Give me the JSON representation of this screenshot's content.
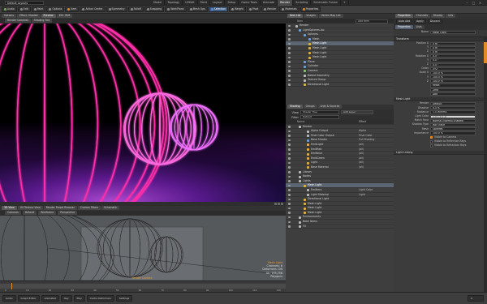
{
  "menubar": {
    "layout": "Default Layouts",
    "tabs": [
      "Model",
      "Topology",
      "UVEdit",
      "Paint",
      "Layout",
      "Setup",
      "Game Tools",
      "Animate",
      "Render",
      "Scripting",
      "Schematic Fusion",
      "+"
    ],
    "active_tab": "Render",
    "window_controls": [
      "–",
      "□",
      "×"
    ]
  },
  "toolbar": {
    "items": [
      {
        "label": "Audio",
        "dot": "g"
      },
      {
        "label": "Edit",
        "dot": ""
      },
      {
        "label": "Paint",
        "dot": ""
      },
      {
        "label": "Options",
        "dot": ""
      },
      {
        "label": "Item",
        "dot": "o"
      },
      {
        "label": "Action Center",
        "dot": ""
      },
      {
        "label": "Symmetry",
        "dot": ""
      },
      {
        "label": "Falloff",
        "dot": ""
      },
      {
        "label": "Snapping",
        "dot": ""
      },
      {
        "label": "WorkPlane",
        "dot": ""
      },
      {
        "label": "Mesh Ops",
        "dot": ""
      },
      {
        "label": "Selection",
        "dot": "b",
        "active": true
      },
      {
        "label": "Weight",
        "dot": ""
      },
      {
        "label": "Pivot",
        "dot": ""
      },
      {
        "label": "Render",
        "dot": ""
      },
      {
        "label": "Materials",
        "dot": ""
      },
      {
        "label": "Properties",
        "dot": "o"
      }
    ]
  },
  "render_view": {
    "tabs": [
      "Options",
      "Effect: Shaded",
      "Preview",
      "IDS: IRrB"
    ],
    "active_tab": "Preview",
    "sub": [
      "Render Cameras",
      "Shading Tint"
    ]
  },
  "viewport": {
    "tabs": [
      "3D View",
      "UV Texture View",
      "Render Preset Browser",
      "Custom Filters",
      "Schematic"
    ],
    "active_tab": "3D View",
    "sub": [
      "Cameras",
      "Default",
      "Wireframe",
      "Perspective"
    ],
    "camera_label": "Render Camera",
    "info": {
      "selected": "Mesh Light",
      "channels": "Channels: 6",
      "deformers": "Deformers: ON",
      "gl": "GL: 193,756",
      "polys": "Polygons",
      "sel": "Ply: 0"
    }
  },
  "timeline": {
    "ticks": [
      "0",
      "10",
      "20",
      "30",
      "40",
      "50",
      "60",
      "70",
      "80",
      "90",
      "100",
      "110",
      "120"
    ]
  },
  "statusbar": {
    "items": [
      "Audio",
      "Graph Editor",
      "Animated",
      "Key",
      "Play",
      "Cache Deformers",
      "Settings"
    ],
    "frame": "0"
  },
  "items_panel": {
    "tabs": [
      "Item List",
      "Images",
      "Vertex Map List"
    ],
    "active_tab": "Item List",
    "col_name": "Item",
    "col_add": "Add Item",
    "rows": [
      {
        "label": "Render",
        "indent": 2,
        "icon": "g"
      },
      {
        "label": "LightSpheres.lxo",
        "indent": 4,
        "icon": "m"
      },
      {
        "label": "Spheres",
        "indent": 7,
        "icon": "m"
      },
      {
        "label": "Mesh",
        "indent": 10,
        "icon": "m"
      },
      {
        "label": "Mesh Light",
        "indent": 10,
        "icon": "y",
        "selected": true
      },
      {
        "label": "Mesh Light",
        "indent": 10,
        "icon": "y"
      },
      {
        "label": "Mesh Light",
        "indent": 10,
        "icon": "y"
      },
      {
        "label": "Mesh Light",
        "indent": 10,
        "icon": "y"
      },
      {
        "label": "Plane",
        "indent": 7,
        "icon": "m"
      },
      {
        "label": "Cylinder",
        "indent": 7,
        "icon": "m"
      },
      {
        "label": "Camera",
        "indent": 7,
        "icon": "c"
      },
      {
        "label": "Baked Geometry",
        "indent": 7,
        "icon": "g"
      },
      {
        "label": "Texture Group",
        "indent": 7,
        "icon": "g"
      },
      {
        "label": "Directional Light",
        "indent": 7,
        "icon": "y"
      }
    ]
  },
  "shader_panel": {
    "tabs": [
      "Shading",
      "Groups",
      "Lists & Sources"
    ],
    "active_tab": "Shading",
    "filter_label": "View",
    "filter_value": "Shader Tree",
    "add_label": "Add Layer",
    "mode_label": "Filter",
    "mode_value": "Default",
    "col_name": "Name",
    "col_effect": "Effect",
    "rows": [
      {
        "label": "Render",
        "indent": 4,
        "val": "",
        "icon": "g"
      },
      {
        "label": "Alpha Output",
        "indent": 9,
        "val": "Alpha",
        "icon": "g"
      },
      {
        "label": "Final Color Output",
        "indent": 9,
        "val": "Final Color",
        "icon": "g"
      },
      {
        "label": "Base Shader",
        "indent": 9,
        "val": "Full Shading",
        "icon": "m"
      },
      {
        "label": "EmitLight",
        "indent": 9,
        "val": "(all)",
        "icon": "o"
      },
      {
        "label": "EmitRed",
        "indent": 9,
        "val": "(all)",
        "icon": "o"
      },
      {
        "label": "Emitblue",
        "indent": 9,
        "val": "(all)",
        "icon": "o"
      },
      {
        "label": "EmitGreen",
        "indent": 9,
        "val": "(all)",
        "icon": "o"
      },
      {
        "label": "Light",
        "indent": 9,
        "val": "(all)",
        "icon": "o"
      },
      {
        "label": "Base Material",
        "indent": 9,
        "val": "(all)",
        "icon": "o"
      },
      {
        "label": "Library",
        "indent": 4,
        "val": "",
        "icon": "g"
      },
      {
        "label": "Nodes",
        "indent": 4,
        "val": "",
        "icon": "g"
      },
      {
        "label": "Lights",
        "indent": 4,
        "val": "",
        "icon": "g"
      },
      {
        "label": "Mesh Light",
        "indent": 7,
        "val": "",
        "icon": "y",
        "selected": true
      },
      {
        "label": "Emitters",
        "indent": 9,
        "val": "Light Color",
        "icon": "g"
      },
      {
        "label": "Light Material",
        "indent": 9,
        "val": "Light",
        "icon": "g"
      },
      {
        "label": "Directional Light",
        "indent": 7,
        "val": "",
        "icon": "y"
      },
      {
        "label": "Mesh Light",
        "indent": 7,
        "val": "",
        "icon": "y"
      },
      {
        "label": "Mesh Light",
        "indent": 7,
        "val": "",
        "icon": "y"
      },
      {
        "label": "Mesh Light",
        "indent": 7,
        "val": "",
        "icon": "y"
      },
      {
        "label": "Environments",
        "indent": 4,
        "val": "",
        "icon": "g"
      },
      {
        "label": "Bake Items",
        "indent": 4,
        "val": "",
        "icon": "g"
      },
      {
        "label": "FX",
        "indent": 4,
        "val": "",
        "icon": "g"
      }
    ]
  },
  "properties": {
    "tabs": [
      "Properties",
      "Channels",
      "Display",
      "Info"
    ],
    "active_tab": "Properties",
    "bar": [
      "Auto Add",
      "Apply",
      "Discard"
    ],
    "subtabs": [
      "Properties",
      "Lists"
    ],
    "name_label": "Name",
    "name_value": "Mesh Light",
    "transform_title": "Transform",
    "transform": [
      {
        "label": "Position X",
        "value": "0 m"
      },
      {
        "label": "Y",
        "value": "0 m"
      },
      {
        "label": "Z",
        "value": "0 m"
      },
      {
        "label": "Rotation X",
        "value": "0.0 °"
      },
      {
        "label": "Y",
        "value": "0.0 °"
      },
      {
        "label": "Z",
        "value": "0.0 °"
      },
      {
        "label": "Order",
        "value": "XYZ"
      },
      {
        "label": "Scale X",
        "value": "100.0 %"
      },
      {
        "label": "Y",
        "value": "100.0 %"
      },
      {
        "label": "Z",
        "value": "100.0 %"
      },
      {
        "label": "",
        "value": "Reset"
      },
      {
        "label": "",
        "value": "Zero"
      },
      {
        "label": "",
        "value": "Add"
      }
    ],
    "light_title": "Mesh Light",
    "light": [
      {
        "label": "Render",
        "value": "Default"
      },
      {
        "label": "Dissolve",
        "value": "0.0 %"
      },
      {
        "label": "Radiance",
        "value": "1.0 W/srm2"
      },
      {
        "label": "Light Color",
        "value": "1.0   1.0   1.0",
        "white": true
      },
      {
        "label": "Match Face",
        "value": "Normal (Normal Shaded)"
      },
      {
        "label": "Shadow Type",
        "value": "Ray Trace"
      },
      {
        "label": "Mesh",
        "value": "Spheres"
      },
      {
        "label": "Importance",
        "value": "100.0 %"
      }
    ],
    "checks": [
      "Visible to Camera",
      "Visible to Reflection Rays",
      "Visible to Refraction Rays"
    ],
    "light_linking": "Light Linking"
  },
  "colors": {
    "accent": "#e08a28",
    "selection": "#5c6673",
    "glow_pink": "#ff3ad0",
    "glow_purple": "#8a2cff"
  }
}
